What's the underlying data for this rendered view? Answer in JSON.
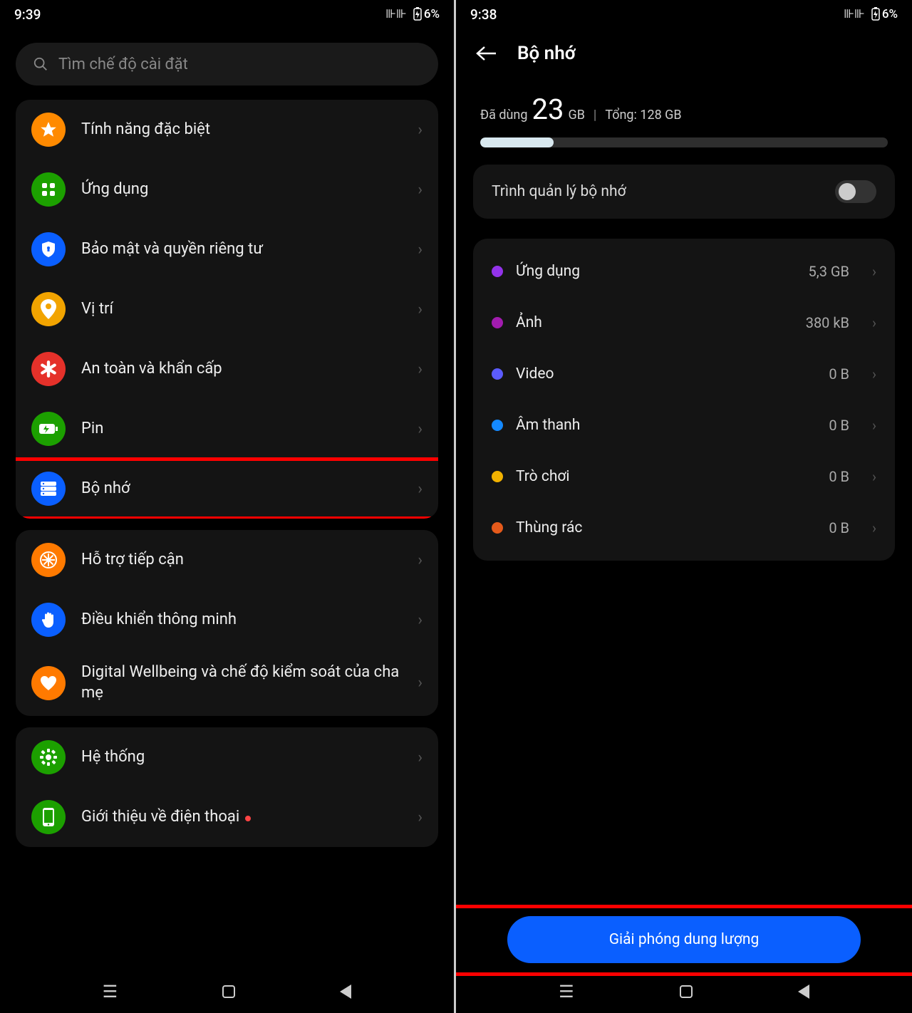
{
  "left": {
    "status": {
      "time": "9:39",
      "battery": "6%"
    },
    "search_placeholder": "Tìm chế độ cài đặt",
    "groups": [
      [
        {
          "key": "special",
          "label": "Tính năng đặc biệt",
          "icon": "star",
          "bg": "#ff8a00"
        },
        {
          "key": "apps",
          "label": "Ứng dụng",
          "icon": "grid",
          "bg": "#1ca000"
        },
        {
          "key": "privacy",
          "label": "Bảo mật và quyền riêng tư",
          "icon": "shield",
          "bg": "#0a5fff"
        },
        {
          "key": "location",
          "label": "Vị trí",
          "icon": "pin",
          "bg": "#f2a400"
        },
        {
          "key": "safety",
          "label": "An toàn và khẩn cấp",
          "icon": "asterisk",
          "bg": "#e5312a"
        },
        {
          "key": "battery",
          "label": "Pin",
          "icon": "battery",
          "bg": "#1ca000"
        },
        {
          "key": "storage",
          "label": "Bộ nhớ",
          "icon": "storage",
          "bg": "#0a5fff",
          "highlight": true
        }
      ],
      [
        {
          "key": "accessibility",
          "label": "Hỗ trợ tiếp cận",
          "icon": "wheel",
          "bg": "#ff7a00"
        },
        {
          "key": "smart",
          "label": "Điều khiển thông minh",
          "icon": "hand",
          "bg": "#0a5fff"
        },
        {
          "key": "wellbeing",
          "label": "Digital Wellbeing và chế độ kiểm soát của cha mẹ",
          "icon": "heart",
          "bg": "#ff7a00"
        }
      ],
      [
        {
          "key": "system",
          "label": "Hệ thống",
          "icon": "gear",
          "bg": "#1ca000"
        },
        {
          "key": "about",
          "label": "Giới thiệu về điện thoại",
          "icon": "phone",
          "bg": "#1ca000",
          "dot": true
        }
      ]
    ]
  },
  "right": {
    "status": {
      "time": "9:38",
      "battery": "6%"
    },
    "title": "Bộ nhớ",
    "used_label": "Đã dùng",
    "used_value": "23",
    "used_unit": "GB",
    "total_label": "Tổng: 128 GB",
    "progress_percent": 18,
    "toggle_label": "Trình quản lý bộ nhớ",
    "categories": [
      {
        "name": "Ứng dụng",
        "size": "5,3 GB",
        "color": "#9333ea"
      },
      {
        "name": "Ảnh",
        "size": "380 kB",
        "color": "#a21caf"
      },
      {
        "name": "Video",
        "size": "0 B",
        "color": "#5b5bff"
      },
      {
        "name": "Âm thanh",
        "size": "0 B",
        "color": "#1489ff"
      },
      {
        "name": "Trò chơi",
        "size": "0 B",
        "color": "#f2b200"
      },
      {
        "name": "Thùng rác",
        "size": "0 B",
        "color": "#e55a1b"
      }
    ],
    "free_button": "Giải phóng dung lượng"
  }
}
